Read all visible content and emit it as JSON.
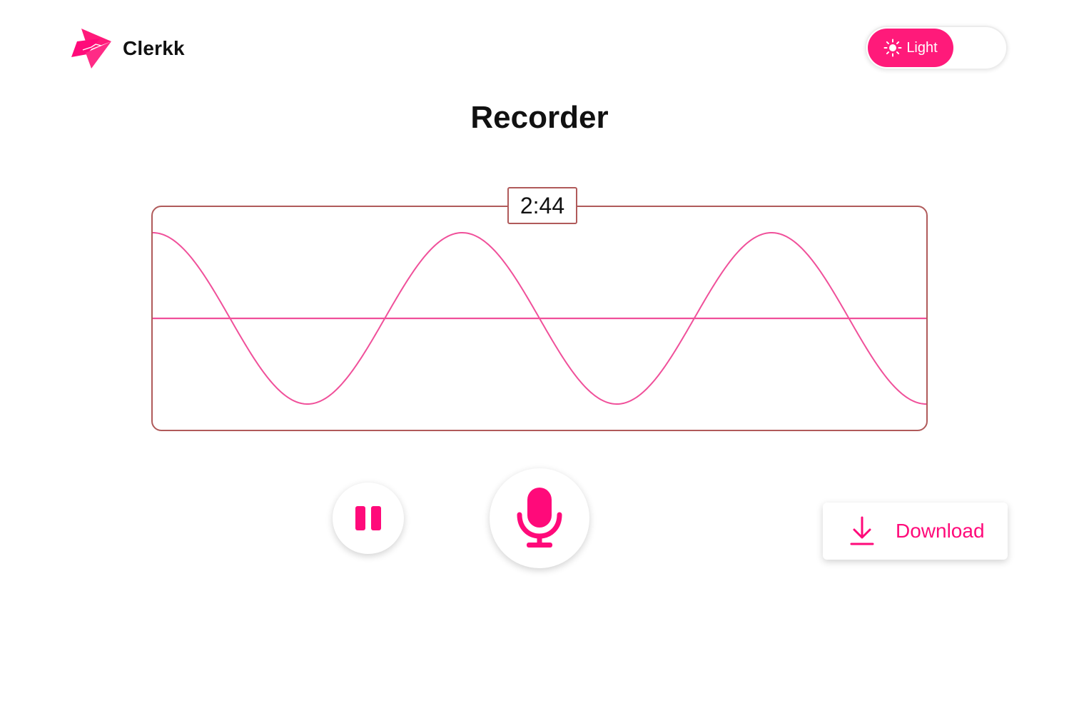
{
  "app": {
    "name": "Clerkk"
  },
  "theme_toggle": {
    "label": "Light",
    "icon": "sun-icon",
    "active": "light"
  },
  "page": {
    "title": "Recorder"
  },
  "recorder": {
    "timer": "2:44",
    "waveform": {
      "cycles": 2.5,
      "amplitude": 1,
      "state": "recording"
    }
  },
  "controls": {
    "pause_icon": "pause-icon",
    "mic_icon": "microphone-icon",
    "download_label": "Download",
    "download_icon": "download-icon"
  },
  "colors": {
    "accent": "#ff0a7a",
    "toggle_bg": "#ff1a7a",
    "wave": "#f0509a",
    "panel_border": "#b05a5a"
  }
}
